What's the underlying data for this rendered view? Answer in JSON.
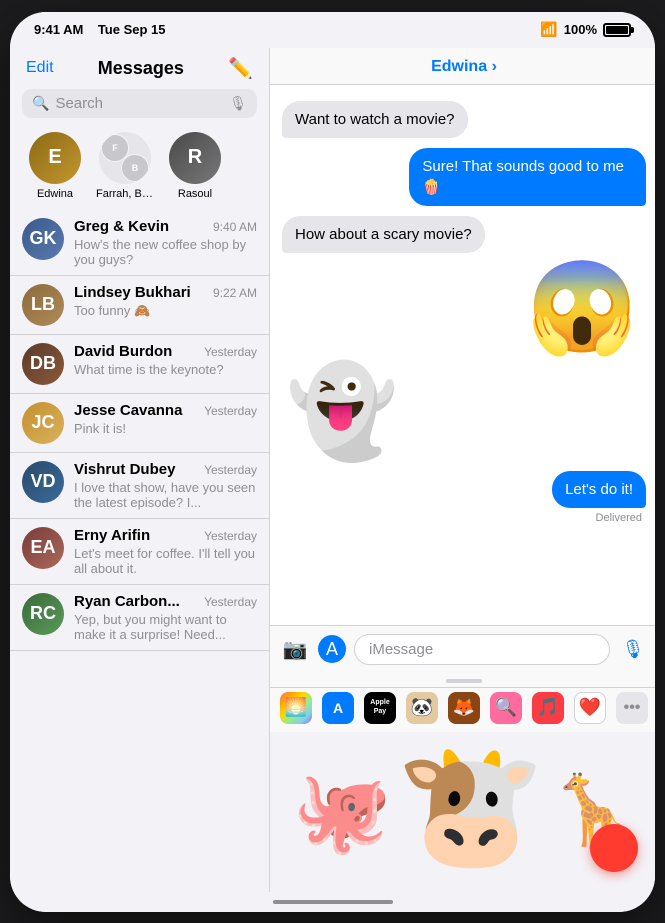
{
  "statusBar": {
    "time": "9:41 AM",
    "day": "Tue Sep 15",
    "battery": "100%"
  },
  "leftPanel": {
    "editLabel": "Edit",
    "title": "Messages",
    "search": {
      "placeholder": "Search"
    },
    "pinnedContacts": [
      {
        "name": "Edwina",
        "initials": "E",
        "colorClass": "av-edwina"
      },
      {
        "name": "Farrah, Brya...",
        "initials": "FB",
        "colorClass": "av-farrah"
      },
      {
        "name": "Rasoul",
        "initials": "R",
        "colorClass": "av-rasoul"
      }
    ],
    "conversations": [
      {
        "name": "Greg & Kevin",
        "time": "9:40 AM",
        "preview": "How's the new coffee shop by you guys?",
        "colorClass": "av-greg",
        "initials": "GK"
      },
      {
        "name": "Lindsey Bukhari",
        "time": "9:22 AM",
        "preview": "Too funny 🙈",
        "colorClass": "av-lindsey",
        "initials": "LB"
      },
      {
        "name": "David Burdon",
        "time": "Yesterday",
        "preview": "What time is the keynote?",
        "colorClass": "av-david",
        "initials": "DB"
      },
      {
        "name": "Jesse Cavanna",
        "time": "Yesterday",
        "preview": "Pink it is!",
        "colorClass": "av-jesse",
        "initials": "JC"
      },
      {
        "name": "Vishrut Dubey",
        "time": "Yesterday",
        "preview": "I love that show, have you seen the latest episode? I...",
        "colorClass": "av-vishrut",
        "initials": "VD"
      },
      {
        "name": "Erny Arifin",
        "time": "Yesterday",
        "preview": "Let's meet for coffee. I'll tell you all about it.",
        "colorClass": "av-erny",
        "initials": "EA"
      },
      {
        "name": "Ryan Carbon...",
        "time": "Yesterday",
        "preview": "Yep, but you might want to make it a surprise! Need...",
        "colorClass": "av-ryan",
        "initials": "RC"
      }
    ]
  },
  "chatPanel": {
    "contactName": "Edwina",
    "chevron": "›",
    "messages": [
      {
        "type": "incoming",
        "text": "Want to watch a movie?"
      },
      {
        "type": "outgoing",
        "text": "Sure! That sounds good to me 🍿"
      },
      {
        "type": "incoming",
        "text": "How about a scary movie?"
      },
      {
        "type": "memoji-incoming",
        "emoji": "😱"
      },
      {
        "type": "ghost",
        "emoji": "👻"
      },
      {
        "type": "outgoing",
        "text": "Let's do it!"
      },
      {
        "type": "delivered",
        "text": "Delivered"
      }
    ],
    "inputBar": {
      "placeholder": "iMessage"
    },
    "appTray": {
      "icons": [
        "🌅",
        "⊕",
        "Apple Pay",
        "🐼",
        "🦊",
        "🔍",
        "🎵",
        "❤️",
        "•••"
      ]
    },
    "memojiShelf": {
      "items": [
        "🐙",
        "🐄",
        "🦒"
      ]
    }
  }
}
